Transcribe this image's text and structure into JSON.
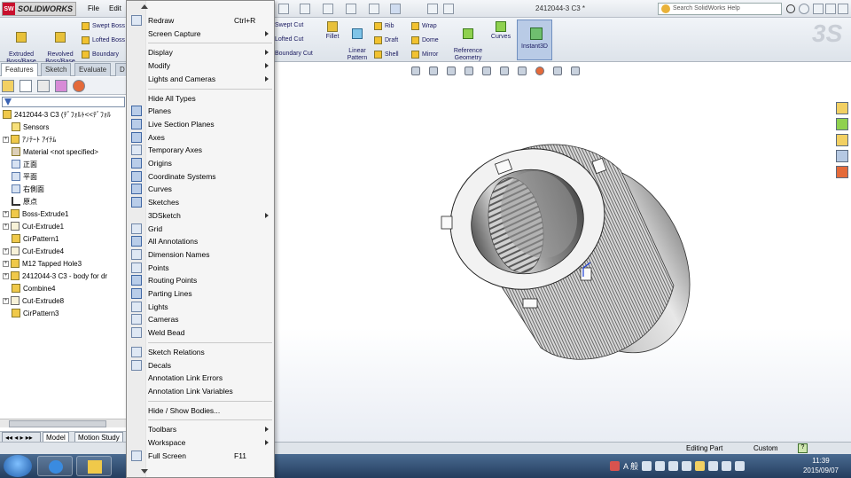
{
  "app": {
    "logo": "SOLIDWORKS",
    "menus": [
      "File",
      "Edit"
    ],
    "doc_title": "2412044-3 C3 *",
    "search_placeholder": "Search SolidWorks Help"
  },
  "command_manager": {
    "tools": [
      {
        "label": "Extruded\nBoss/Base"
      },
      {
        "label": "Revolved\nBoss/Base"
      }
    ],
    "stack1": [
      "Swept Boss",
      "Lofted Boss",
      "Boundary"
    ],
    "stack2": [
      "Swept Cut",
      "Lofted Cut",
      "Boundary Cut"
    ],
    "fillet": "Fillet",
    "linear_pattern": "Linear\nPattern",
    "stack3": [
      "Rib",
      "Draft",
      "Shell"
    ],
    "stack4": [
      "Wrap",
      "Dome",
      "Mirror"
    ],
    "reference_geometry": "Reference\nGeometry",
    "curves": "Curves",
    "instant3d": "Instant3D"
  },
  "feature_manager": {
    "tabs": [
      "Features",
      "Sketch",
      "Evaluate",
      "D"
    ],
    "tree": [
      {
        "label": "2412044-3 C3 (ﾃﾞﾌｫﾙﾄ<<ﾃﾞﾌｫﾙ",
        "icon": "part-icon",
        "expand": "",
        "indent": 0
      },
      {
        "label": "Sensors",
        "icon": "sensor-icon",
        "expand": "",
        "indent": 1
      },
      {
        "label": "ｱﾉﾃｰﾄ ｱｲﾃﾑ",
        "icon": "annotation-icon",
        "expand": "+",
        "indent": 0
      },
      {
        "label": "Material <not specified>",
        "icon": "material-icon",
        "expand": "",
        "indent": 1
      },
      {
        "label": "正面",
        "icon": "plane-icon",
        "expand": "",
        "indent": 1
      },
      {
        "label": "平面",
        "icon": "plane-icon",
        "expand": "",
        "indent": 1
      },
      {
        "label": "右側面",
        "icon": "plane-icon",
        "expand": "",
        "indent": 1
      },
      {
        "label": "原点",
        "icon": "origin-icon",
        "expand": "",
        "indent": 1
      },
      {
        "label": "Boss-Extrude1",
        "icon": "extrude-icon",
        "expand": "+",
        "indent": 0
      },
      {
        "label": "Cut-Extrude1",
        "icon": "cut-extrude-icon",
        "expand": "+",
        "indent": 0
      },
      {
        "label": "CirPattern1",
        "icon": "pattern-icon",
        "expand": "",
        "indent": 1
      },
      {
        "label": "Cut-Extrude4",
        "icon": "cut-extrude-icon",
        "expand": "+",
        "indent": 0
      },
      {
        "label": "M12 Tapped Hole3",
        "icon": "hole-icon",
        "expand": "+",
        "indent": 0
      },
      {
        "label": "2412044-3 C3 - body for dr",
        "icon": "part-icon",
        "expand": "+",
        "indent": 0
      },
      {
        "label": "Combine4",
        "icon": "combine-icon",
        "expand": "",
        "indent": 1
      },
      {
        "label": "Cut-Extrude8",
        "icon": "cut-extrude-icon",
        "expand": "+",
        "indent": 0
      },
      {
        "label": "CirPattern3",
        "icon": "pattern-icon",
        "expand": "",
        "indent": 1
      }
    ],
    "bottom_tabs": [
      "Model",
      "Motion Study"
    ]
  },
  "view_menu": {
    "items": [
      {
        "type": "item",
        "label": "Redraw",
        "shortcut": "Ctrl+R",
        "icon": "redraw-icon"
      },
      {
        "type": "item",
        "label": "Screen Capture",
        "submenu": true
      },
      {
        "type": "sep"
      },
      {
        "type": "item",
        "label": "Display",
        "submenu": true
      },
      {
        "type": "item",
        "label": "Modify",
        "submenu": true
      },
      {
        "type": "item",
        "label": "Lights and Cameras",
        "submenu": true
      },
      {
        "type": "sep"
      },
      {
        "type": "item",
        "label": "Hide All Types"
      },
      {
        "type": "item",
        "label": "Planes",
        "icon": "planes-icon",
        "checked": true
      },
      {
        "type": "item",
        "label": "Live Section Planes",
        "icon": "live-section-icon",
        "checked": true
      },
      {
        "type": "item",
        "label": "Axes",
        "icon": "axes-icon",
        "checked": true
      },
      {
        "type": "item",
        "label": "Temporary Axes",
        "icon": "temporary-axes-icon"
      },
      {
        "type": "item",
        "label": "Origins",
        "icon": "origins-icon",
        "checked": true
      },
      {
        "type": "item",
        "label": "Coordinate Systems",
        "icon": "coordinate-systems-icon",
        "checked": true
      },
      {
        "type": "item",
        "label": "Curves",
        "icon": "curves-icon",
        "checked": true
      },
      {
        "type": "item",
        "label": "Sketches",
        "icon": "sketches-icon",
        "checked": true
      },
      {
        "type": "item",
        "label": "3DSketch",
        "submenu": true
      },
      {
        "type": "item",
        "label": "Grid",
        "icon": "grid-icon"
      },
      {
        "type": "item",
        "label": "All Annotations",
        "icon": "annotations-icon",
        "checked": true
      },
      {
        "type": "item",
        "label": "Dimension Names",
        "icon": "dimension-names-icon"
      },
      {
        "type": "item",
        "label": "Points",
        "icon": "points-icon"
      },
      {
        "type": "item",
        "label": "Routing Points",
        "icon": "routing-points-icon",
        "checked": true
      },
      {
        "type": "item",
        "label": "Parting Lines",
        "icon": "parting-lines-icon",
        "checked": true
      },
      {
        "type": "item",
        "label": "Lights",
        "icon": "lights-icon"
      },
      {
        "type": "item",
        "label": "Cameras",
        "icon": "cameras-icon"
      },
      {
        "type": "item",
        "label": "Weld Bead",
        "icon": "weld-bead-icon"
      },
      {
        "type": "sep"
      },
      {
        "type": "item",
        "label": "Sketch Relations",
        "icon": "sketch-relations-icon"
      },
      {
        "type": "item",
        "label": "Decals",
        "icon": "decals-icon"
      },
      {
        "type": "item",
        "label": "Annotation Link Errors"
      },
      {
        "type": "item",
        "label": "Annotation Link Variables"
      },
      {
        "type": "sep"
      },
      {
        "type": "item",
        "label": "Hide / Show Bodies..."
      },
      {
        "type": "sep"
      },
      {
        "type": "item",
        "label": "Toolbars",
        "submenu": true
      },
      {
        "type": "item",
        "label": "Workspace",
        "submenu": true
      },
      {
        "type": "item",
        "label": "Full Screen",
        "shortcut": "F11",
        "icon": "full-screen-icon"
      }
    ]
  },
  "status": {
    "mode": "Editing Part",
    "units": "Custom",
    "help": "?"
  },
  "taskbar": {
    "ime": "A 般",
    "time": "11:39",
    "date": "2015/09/07"
  }
}
